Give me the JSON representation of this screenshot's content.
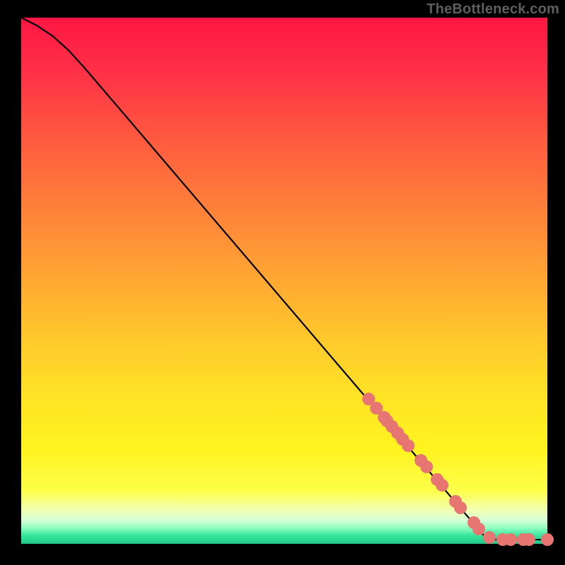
{
  "source_label": "TheBottleneck.com",
  "colors": {
    "dot": "#e77572",
    "curve": "#000000",
    "frame": "#000000"
  },
  "chart_data": {
    "type": "line",
    "title": "",
    "xlabel": "",
    "ylabel": "",
    "xlim": [
      0,
      100
    ],
    "ylim": [
      0,
      100
    ],
    "curve": {
      "x": [
        0,
        3,
        6,
        9,
        12,
        15,
        88,
        90,
        100
      ],
      "y": [
        100,
        98.5,
        96.5,
        93.8,
        90.5,
        87,
        1.5,
        0.8,
        0.8
      ]
    },
    "series": [
      {
        "name": "highlighted-points",
        "x": [
          66,
          67.5,
          69,
          69.5,
          70.5,
          71.5,
          72.5,
          73.5,
          76,
          77,
          79,
          80,
          82.5,
          83.5,
          86,
          87,
          89,
          91.5,
          93,
          95.5,
          96.5,
          100
        ],
        "y": [
          27.5,
          25.8,
          24,
          23.4,
          22.3,
          21.1,
          19.9,
          18.7,
          15.8,
          14.6,
          12.2,
          11.1,
          8.1,
          6.9,
          4.0,
          2.8,
          1.2,
          0.8,
          0.8,
          0.8,
          0.8,
          0.8
        ]
      }
    ]
  }
}
